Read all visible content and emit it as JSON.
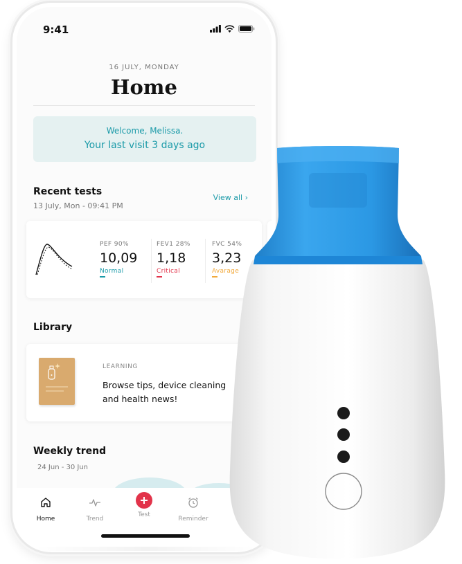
{
  "status_bar": {
    "time": "9:41"
  },
  "header": {
    "date": "16 JULY, MONDAY",
    "title": "Home"
  },
  "welcome": {
    "greeting": "Welcome, Melissa.",
    "last_visit": "Your last visit 3 days ago"
  },
  "recent_tests": {
    "title": "Recent tests",
    "subtitle": "13 July, Mon - 09:41 PM",
    "view_all": "View all",
    "metrics": [
      {
        "label": "PEF 90%",
        "value": "10,09",
        "status": "Normal",
        "color": "#1a9aa8"
      },
      {
        "label": "FEV1 28%",
        "value": "1,18",
        "status": "Critical",
        "color": "#e2334a"
      },
      {
        "label": "FVC 54%",
        "value": "3,23",
        "status": "Avarage",
        "color": "#f2a93b"
      }
    ]
  },
  "library": {
    "title": "Library",
    "category": "LEARNING",
    "text": "Browse tips, device cleaning and health news!"
  },
  "weekly_trend": {
    "title": "Weekly trend",
    "range": "24 Jun - 30 Jun"
  },
  "tabs": [
    {
      "label": "Home",
      "icon": "home-icon",
      "active": true
    },
    {
      "label": "Trend",
      "icon": "trend-icon",
      "active": false
    },
    {
      "label": "Test",
      "icon": "plus-icon",
      "active": false
    },
    {
      "label": "Reminder",
      "icon": "alarm-icon",
      "active": false
    }
  ],
  "colors": {
    "accent": "#1a9aa8",
    "critical": "#e2334a",
    "average": "#f2a93b",
    "test_button": "#e2334a",
    "device_mouthpiece": "#2196e0",
    "welcome_bg": "#e5f1f1"
  }
}
